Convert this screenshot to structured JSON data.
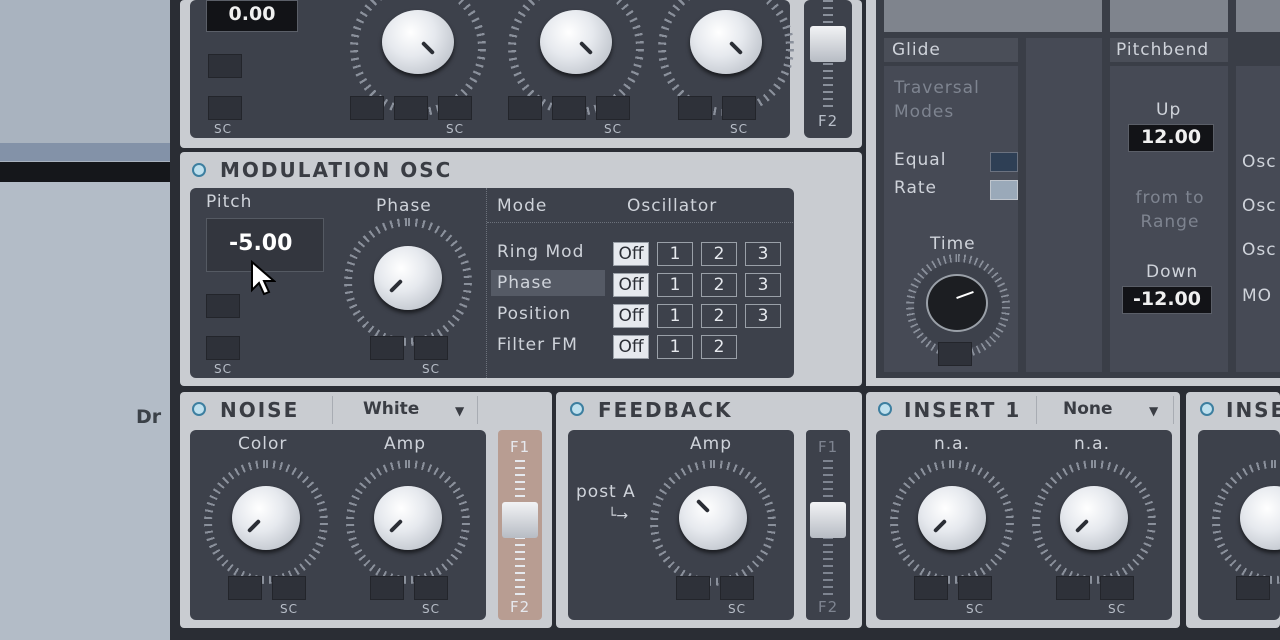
{
  "host": {
    "side_text": "Dr"
  },
  "top_panel": {
    "value": "0.00",
    "sc": "SC",
    "dash": "–",
    "f2": "F2"
  },
  "mod_osc": {
    "title": "MODULATION OSC",
    "pitch_label": "Pitch",
    "pitch_value": "-5.00",
    "phase_label": "Phase",
    "mode_label": "Mode",
    "osc_label": "Oscillator",
    "rows": [
      {
        "label": "Ring Mod",
        "off": "Off",
        "opts": [
          "1",
          "2",
          "3"
        ]
      },
      {
        "label": "Phase",
        "off": "Off",
        "opts": [
          "1",
          "2",
          "3"
        ]
      },
      {
        "label": "Position",
        "off": "Off",
        "opts": [
          "1",
          "2",
          "3"
        ]
      },
      {
        "label": "Filter FM",
        "off": "Off",
        "opts": [
          "1",
          "2"
        ]
      }
    ],
    "sc": "SC",
    "dash": "–"
  },
  "glide": {
    "title": "Glide",
    "traversal": "Traversal Modes",
    "equal": "Equal",
    "rate": "Rate",
    "time": "Time"
  },
  "pitchbend": {
    "title": "Pitchbend",
    "up": "Up",
    "up_value": "12.00",
    "range": "from to Range",
    "down": "Down",
    "down_value": "-12.00"
  },
  "right_edge": {
    "osc1": "Osc",
    "osc2": "Osc",
    "osc3": "Osc",
    "mo": "MO"
  },
  "noise": {
    "title": "NOISE",
    "type": "White",
    "color": "Color",
    "amp": "Amp",
    "f1": "F1",
    "f2": "F2",
    "sc": "SC",
    "dash": "–"
  },
  "feedback": {
    "title": "FEEDBACK",
    "amp": "Amp",
    "post": "post A",
    "f1": "F1",
    "f2": "F2",
    "sc": "SC",
    "dash": "–"
  },
  "insert1": {
    "title": "INSERT 1",
    "type": "None",
    "knob1": "n.a.",
    "knob2": "n.a.",
    "sc": "SC",
    "dash": "–"
  },
  "insert2": {
    "title": "INSE"
  }
}
